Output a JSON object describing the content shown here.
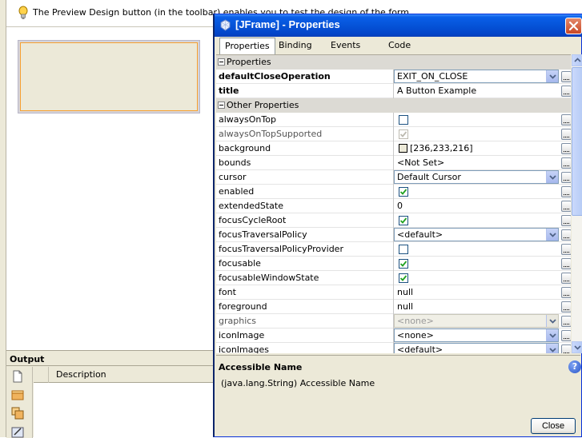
{
  "ide": {
    "hint_text": "The Preview Design button (in the toolbar) enables you to test the design of the form.",
    "output": {
      "title": "Output",
      "column_description": "Description"
    }
  },
  "dialog": {
    "title": "[JFrame] - Properties",
    "tabs": [
      "Properties",
      "Binding",
      "Events",
      "Code"
    ],
    "active_tab": "Properties",
    "categories": {
      "properties": "Properties",
      "other": "Other Properties"
    },
    "properties": [
      {
        "name": "defaultCloseOperation",
        "type": "combo",
        "value": "EXIT_ON_CLOSE",
        "bold": true
      },
      {
        "name": "title",
        "type": "text",
        "value": "A Button Example",
        "bold": true
      }
    ],
    "other_properties": [
      {
        "name": "alwaysOnTop",
        "type": "checkbox",
        "checked": false
      },
      {
        "name": "alwaysOnTopSupported",
        "type": "checkbox",
        "checked": true,
        "disabled": true
      },
      {
        "name": "background",
        "type": "color",
        "value": "[236,233,216]"
      },
      {
        "name": "bounds",
        "type": "text",
        "value": "<Not Set>"
      },
      {
        "name": "cursor",
        "type": "combo",
        "value": "Default Cursor"
      },
      {
        "name": "enabled",
        "type": "checkbox",
        "checked": true
      },
      {
        "name": "extendedState",
        "type": "text",
        "value": "0"
      },
      {
        "name": "focusCycleRoot",
        "type": "checkbox",
        "checked": true
      },
      {
        "name": "focusTraversalPolicy",
        "type": "combo",
        "value": "<default>"
      },
      {
        "name": "focusTraversalPolicyProvider",
        "type": "checkbox",
        "checked": false
      },
      {
        "name": "focusable",
        "type": "checkbox",
        "checked": true
      },
      {
        "name": "focusableWindowState",
        "type": "checkbox",
        "checked": true
      },
      {
        "name": "font",
        "type": "text",
        "value": "null"
      },
      {
        "name": "foreground",
        "type": "text",
        "value": "null"
      },
      {
        "name": "graphics",
        "type": "combo",
        "value": "<none>",
        "disabled": true
      },
      {
        "name": "iconImage",
        "type": "combo",
        "value": "<none>"
      },
      {
        "name": "iconImages",
        "type": "combo",
        "value": "<default>"
      }
    ],
    "help": {
      "title": "Accessible Name",
      "description": "(java.lang.String) Accessible Name"
    },
    "close_label": "Close",
    "colors": {
      "title_bar": "#0553d8",
      "dialog_bg": "#ece9d8",
      "check_green": "#21a121",
      "combo_border": "#7f9db9"
    }
  }
}
